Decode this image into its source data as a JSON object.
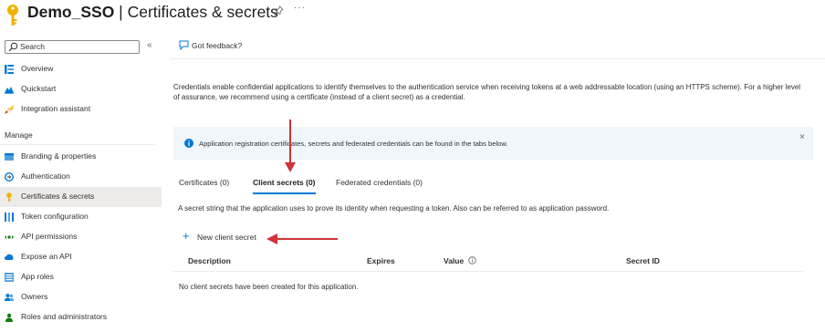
{
  "header": {
    "title_bold": "Demo_SSO",
    "title_rest": " | Certificates & secrets",
    "more_label": "···"
  },
  "sidebar": {
    "search_placeholder": "Search",
    "collapse_label": "«",
    "section_manage": "Manage",
    "items": [
      {
        "label": "Overview",
        "icon": "overview-icon"
      },
      {
        "label": "Quickstart",
        "icon": "quickstart-icon"
      },
      {
        "label": "Integration assistant",
        "icon": "rocket-icon"
      },
      {
        "label": "Branding & properties",
        "icon": "branding-icon"
      },
      {
        "label": "Authentication",
        "icon": "authentication-icon"
      },
      {
        "label": "Certificates & secrets",
        "icon": "key-icon",
        "active": true
      },
      {
        "label": "Token configuration",
        "icon": "token-icon"
      },
      {
        "label": "API permissions",
        "icon": "api-permissions-icon"
      },
      {
        "label": "Expose an API",
        "icon": "cloud-icon"
      },
      {
        "label": "App roles",
        "icon": "app-roles-icon"
      },
      {
        "label": "Owners",
        "icon": "owners-icon"
      },
      {
        "label": "Roles and administrators",
        "icon": "roles-icon"
      }
    ]
  },
  "main": {
    "feedback_label": "Got feedback?",
    "description": "Credentials enable confidential applications to identify themselves to the authentication service when receiving tokens at a web addressable location (using an HTTPS scheme). For a higher level of assurance, we recommend using a certificate (instead of a client secret) as a credential.",
    "info_text": "Application registration certificates, secrets and federated credentials can be found in the tabs below.",
    "close_label": "×",
    "tabs": [
      {
        "label": "Certificates (0)"
      },
      {
        "label": "Client secrets (0)",
        "active": true
      },
      {
        "label": "Federated credentials (0)"
      }
    ],
    "tab_description": "A secret string that the application uses to prove its identity when requesting a token. Also can be referred to as application password.",
    "new_secret_label": "New client secret",
    "table": {
      "headers": [
        "Description",
        "Expires",
        "Value",
        "Secret ID"
      ],
      "empty_message": "No client secrets have been created for this application."
    }
  },
  "colors": {
    "accent": "#0078d4",
    "annotation_arrow": "#d13438",
    "info_bg": "#eff6fc",
    "active_nav_bg": "#edebe9"
  }
}
